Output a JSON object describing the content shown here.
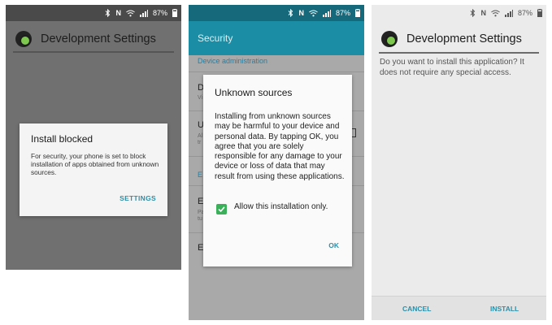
{
  "status_bar": {
    "icons": [
      "bluetooth-icon",
      "nfc-icon",
      "wifi-icon",
      "signal-icon",
      "battery-icon"
    ],
    "nfc_label": "N",
    "battery": "87%"
  },
  "colors": {
    "accent": "#2d8fa8",
    "toolbar": "#1b8ea5",
    "dim_overlay": "#707070",
    "checkbox": "#3caf5a"
  },
  "panel1": {
    "app_title": "Development Settings",
    "dialog": {
      "title": "Install blocked",
      "message": "For security, your phone is set to block installation of apps obtained from unknown sources.",
      "button": "SETTINGS"
    }
  },
  "panel2": {
    "toolbar_title": "Security",
    "section_header": "Device administration",
    "items": [
      {
        "title": "D",
        "subtitle": "Vi"
      },
      {
        "title": "U",
        "subtitle": "Al"
      },
      {
        "subtitle_2": "tr"
      },
      {
        "section": "E"
      },
      {
        "title": "E",
        "subtitle": "Pa"
      },
      {
        "subtitle_2": "tu"
      },
      {
        "title": "E"
      }
    ],
    "dialog": {
      "title": "Unknown sources",
      "message": "Installing from unknown sources may be harmful to your device and personal data. By tapping OK, you agree that you are solely responsible for any damage to your device or loss of data that may result from using these applications.",
      "checkbox_label": "Allow this installation only.",
      "checkbox_checked": true,
      "button": "OK"
    }
  },
  "panel3": {
    "app_title": "Development Settings",
    "message": "Do you want to install this application? It does not require any special access.",
    "cancel": "CANCEL",
    "install": "INSTALL"
  }
}
